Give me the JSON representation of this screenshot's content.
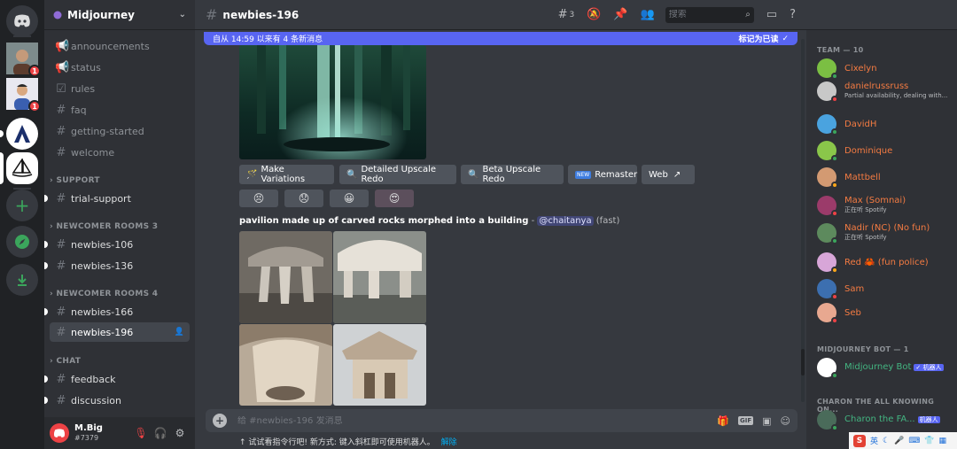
{
  "colors": {
    "accent": "#5865f2",
    "online": "#3ba55c",
    "dnd": "#ed4245",
    "idle": "#faa61a",
    "team_orange": "#f47b42",
    "bot_green": "#43b581"
  },
  "rail": {
    "servers": [
      {
        "name": "home",
        "icon": "discord-icon"
      },
      {
        "name": "server-1",
        "badge": "1"
      },
      {
        "name": "server-2",
        "badge": "1"
      },
      {
        "name": "server-3"
      },
      {
        "name": "server-4"
      }
    ]
  },
  "sidebar": {
    "guild_name": "Midjourney",
    "channels_top": [
      "announcements",
      "status",
      "rules",
      "faq",
      "getting-started",
      "welcome"
    ],
    "cat_support": "SUPPORT",
    "support": [
      "trial-support"
    ],
    "cat_rooms3": "NEWCOMER ROOMS 3",
    "rooms3": [
      "newbies-106",
      "newbies-136"
    ],
    "cat_rooms4": "NEWCOMER ROOMS 4",
    "rooms4": [
      "newbies-166",
      "newbies-196"
    ],
    "cat_chat": "CHAT",
    "chat": [
      "feedback",
      "discussion"
    ]
  },
  "user": {
    "name": "M.Big",
    "tag": "#7379"
  },
  "topbar": {
    "channel": "newbies-196",
    "threads_count": "3",
    "search_placeholder": "搜索"
  },
  "new_messages": {
    "text": "自从 14:59 以来有 4 条新消息",
    "mark_read": "标记为已读"
  },
  "buttons": [
    "Make Variations",
    "Detailed Upscale Redo",
    "Beta Upscale Redo",
    "Remaster",
    "Web"
  ],
  "reactions": [
    "😣",
    "😞",
    "😀",
    "😍"
  ],
  "message": {
    "prompt": "pavilion made up of carved rocks morphed into a building",
    "dash": "-",
    "mention": "@chaitanya",
    "speed": "(fast)"
  },
  "composer": {
    "placeholder": "给 #newbies-196 发消息"
  },
  "hint": {
    "text": "试试看指令行吧! 新方式: 键入斜杠即可使用机器人。",
    "dismiss": "解除"
  },
  "members": {
    "cat_team": "TEAM — 10",
    "team": [
      {
        "name": "Cixelyn",
        "sub": "",
        "status": "online",
        "color": "#f47b42",
        "av": "#7bbf43"
      },
      {
        "name": "danielrussruss",
        "sub": "Partial availability, dealing with...",
        "status": "dnd",
        "color": "#f47b42",
        "av": "#c8c8c8"
      },
      {
        "name": "DavidH",
        "sub": "",
        "status": "online",
        "color": "#f47b42",
        "av": "#4aa3df"
      },
      {
        "name": "Dominique",
        "sub": "",
        "status": "online",
        "color": "#f47b42",
        "av": "#8ac64a"
      },
      {
        "name": "Mattbell",
        "sub": "",
        "status": "idle",
        "color": "#f47b42",
        "av": "#d39a72"
      },
      {
        "name": "Max (Somnai)",
        "sub": "正在听 Spotify",
        "status": "dnd",
        "color": "#f47b42",
        "av": "#9b3b6a"
      },
      {
        "name": "Nadir (NC) (No fun)",
        "sub": "正在听 Spotify",
        "status": "online",
        "color": "#f47b42",
        "av": "#5d8a5d"
      },
      {
        "name": "Red 🦀 (fun police)",
        "sub": "",
        "status": "idle",
        "color": "#f47b42",
        "av": "#d8a6d8"
      },
      {
        "name": "Sam",
        "sub": "",
        "status": "dnd",
        "color": "#f47b42",
        "av": "#3c6fb0"
      },
      {
        "name": "Seb",
        "sub": "",
        "status": "dnd",
        "color": "#f47b42",
        "av": "#e8a890"
      }
    ],
    "cat_bot": "MIDJOURNEY BOT — 1",
    "bot": {
      "name": "Midjourney Bot",
      "tag": "✓ 机器人"
    },
    "cat_charon": "CHARON THE ALL KNOWING ON...",
    "charon": {
      "name": "Charon the FA...",
      "tag": "机器人"
    }
  },
  "ime": {
    "label": "英"
  }
}
